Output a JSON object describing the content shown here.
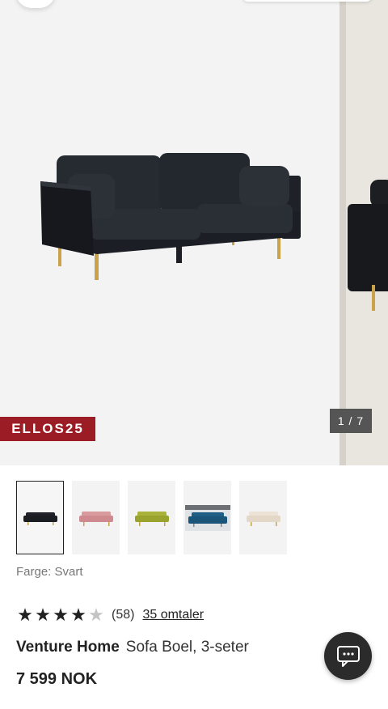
{
  "gallery": {
    "promo_code": "ELLOS25",
    "counter": "1 / 7"
  },
  "thumbnails": [
    {
      "label": "Svart",
      "color": "#1f2228",
      "selected": true
    },
    {
      "label": "Rosa",
      "color": "#d99a9e",
      "selected": false
    },
    {
      "label": "Grønn",
      "color": "#a9b23a",
      "selected": false
    },
    {
      "label": "Blå",
      "color": "#1f5f86",
      "selected": false
    },
    {
      "label": "Beige",
      "color": "#ece2d6",
      "selected": false
    }
  ],
  "product": {
    "color_label": "Farge: Svart",
    "rating": 4,
    "rating_max": 5,
    "rating_count": "(58)",
    "reviews_link": "35 omtaler",
    "brand": "Venture Home",
    "name": "Sofa Boel, 3-seter",
    "price": "7 599 NOK"
  },
  "icons": {
    "chat": "chat-bubble-icon"
  }
}
